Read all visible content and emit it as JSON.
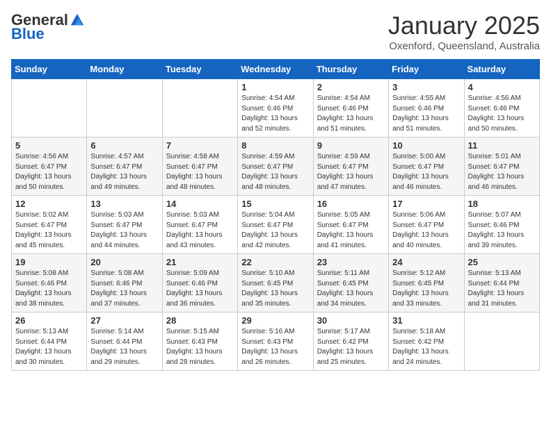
{
  "header": {
    "logo_general": "General",
    "logo_blue": "Blue",
    "title": "January 2025",
    "location": "Oxenford, Queensland, Australia"
  },
  "days_of_week": [
    "Sunday",
    "Monday",
    "Tuesday",
    "Wednesday",
    "Thursday",
    "Friday",
    "Saturday"
  ],
  "weeks": [
    [
      {
        "day": "",
        "info": ""
      },
      {
        "day": "",
        "info": ""
      },
      {
        "day": "",
        "info": ""
      },
      {
        "day": "1",
        "info": "Sunrise: 4:54 AM\nSunset: 6:46 PM\nDaylight: 13 hours\nand 52 minutes."
      },
      {
        "day": "2",
        "info": "Sunrise: 4:54 AM\nSunset: 6:46 PM\nDaylight: 13 hours\nand 51 minutes."
      },
      {
        "day": "3",
        "info": "Sunrise: 4:55 AM\nSunset: 6:46 PM\nDaylight: 13 hours\nand 51 minutes."
      },
      {
        "day": "4",
        "info": "Sunrise: 4:56 AM\nSunset: 6:46 PM\nDaylight: 13 hours\nand 50 minutes."
      }
    ],
    [
      {
        "day": "5",
        "info": "Sunrise: 4:56 AM\nSunset: 6:47 PM\nDaylight: 13 hours\nand 50 minutes."
      },
      {
        "day": "6",
        "info": "Sunrise: 4:57 AM\nSunset: 6:47 PM\nDaylight: 13 hours\nand 49 minutes."
      },
      {
        "day": "7",
        "info": "Sunrise: 4:58 AM\nSunset: 6:47 PM\nDaylight: 13 hours\nand 48 minutes."
      },
      {
        "day": "8",
        "info": "Sunrise: 4:59 AM\nSunset: 6:47 PM\nDaylight: 13 hours\nand 48 minutes."
      },
      {
        "day": "9",
        "info": "Sunrise: 4:59 AM\nSunset: 6:47 PM\nDaylight: 13 hours\nand 47 minutes."
      },
      {
        "day": "10",
        "info": "Sunrise: 5:00 AM\nSunset: 6:47 PM\nDaylight: 13 hours\nand 46 minutes."
      },
      {
        "day": "11",
        "info": "Sunrise: 5:01 AM\nSunset: 6:47 PM\nDaylight: 13 hours\nand 46 minutes."
      }
    ],
    [
      {
        "day": "12",
        "info": "Sunrise: 5:02 AM\nSunset: 6:47 PM\nDaylight: 13 hours\nand 45 minutes."
      },
      {
        "day": "13",
        "info": "Sunrise: 5:03 AM\nSunset: 6:47 PM\nDaylight: 13 hours\nand 44 minutes."
      },
      {
        "day": "14",
        "info": "Sunrise: 5:03 AM\nSunset: 6:47 PM\nDaylight: 13 hours\nand 43 minutes."
      },
      {
        "day": "15",
        "info": "Sunrise: 5:04 AM\nSunset: 6:47 PM\nDaylight: 13 hours\nand 42 minutes."
      },
      {
        "day": "16",
        "info": "Sunrise: 5:05 AM\nSunset: 6:47 PM\nDaylight: 13 hours\nand 41 minutes."
      },
      {
        "day": "17",
        "info": "Sunrise: 5:06 AM\nSunset: 6:47 PM\nDaylight: 13 hours\nand 40 minutes."
      },
      {
        "day": "18",
        "info": "Sunrise: 5:07 AM\nSunset: 6:46 PM\nDaylight: 13 hours\nand 39 minutes."
      }
    ],
    [
      {
        "day": "19",
        "info": "Sunrise: 5:08 AM\nSunset: 6:46 PM\nDaylight: 13 hours\nand 38 minutes."
      },
      {
        "day": "20",
        "info": "Sunrise: 5:08 AM\nSunset: 6:46 PM\nDaylight: 13 hours\nand 37 minutes."
      },
      {
        "day": "21",
        "info": "Sunrise: 5:09 AM\nSunset: 6:46 PM\nDaylight: 13 hours\nand 36 minutes."
      },
      {
        "day": "22",
        "info": "Sunrise: 5:10 AM\nSunset: 6:45 PM\nDaylight: 13 hours\nand 35 minutes."
      },
      {
        "day": "23",
        "info": "Sunrise: 5:11 AM\nSunset: 6:45 PM\nDaylight: 13 hours\nand 34 minutes."
      },
      {
        "day": "24",
        "info": "Sunrise: 5:12 AM\nSunset: 6:45 PM\nDaylight: 13 hours\nand 33 minutes."
      },
      {
        "day": "25",
        "info": "Sunrise: 5:13 AM\nSunset: 6:44 PM\nDaylight: 13 hours\nand 31 minutes."
      }
    ],
    [
      {
        "day": "26",
        "info": "Sunrise: 5:13 AM\nSunset: 6:44 PM\nDaylight: 13 hours\nand 30 minutes."
      },
      {
        "day": "27",
        "info": "Sunrise: 5:14 AM\nSunset: 6:44 PM\nDaylight: 13 hours\nand 29 minutes."
      },
      {
        "day": "28",
        "info": "Sunrise: 5:15 AM\nSunset: 6:43 PM\nDaylight: 13 hours\nand 28 minutes."
      },
      {
        "day": "29",
        "info": "Sunrise: 5:16 AM\nSunset: 6:43 PM\nDaylight: 13 hours\nand 26 minutes."
      },
      {
        "day": "30",
        "info": "Sunrise: 5:17 AM\nSunset: 6:42 PM\nDaylight: 13 hours\nand 25 minutes."
      },
      {
        "day": "31",
        "info": "Sunrise: 5:18 AM\nSunset: 6:42 PM\nDaylight: 13 hours\nand 24 minutes."
      },
      {
        "day": "",
        "info": ""
      }
    ]
  ]
}
